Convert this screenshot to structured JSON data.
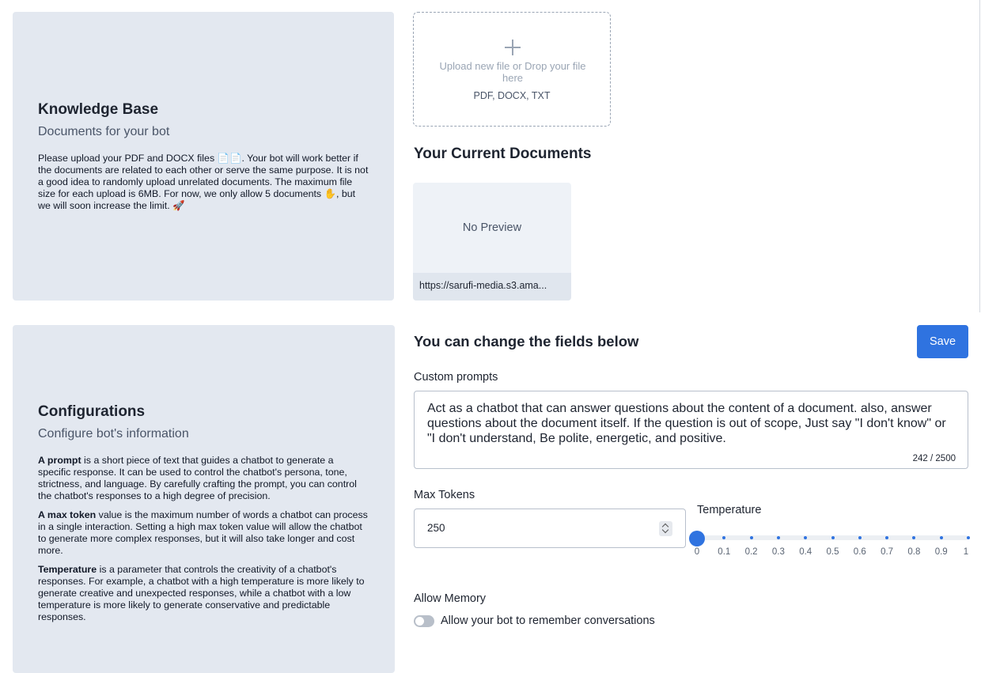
{
  "knowledge_base": {
    "title": "Knowledge Base",
    "subtitle": "Documents for your bot",
    "description": "Please upload your PDF and DOCX files 📄📄. Your bot will work better if the documents are related to each other or serve the same purpose. It is not a good idea to randomly upload unrelated documents. The maximum file size for each upload is 6MB. For now, we only allow 5 documents ✋, but we will soon increase the limit. 🚀"
  },
  "upload": {
    "icon": "plus-icon",
    "prompt": "Upload new file or Drop your file here",
    "types": "PDF, DOCX, TXT"
  },
  "documents": {
    "title": "Your Current Documents",
    "items": [
      {
        "preview": "No Preview",
        "url": "https://sarufi-media.s3.ama..."
      }
    ]
  },
  "configurations": {
    "title": "Configurations",
    "subtitle": "Configure bot's information",
    "prompt_term": "A prompt",
    "prompt_desc": " is a short piece of text that guides a chatbot to generate a specific response. It can be used to control the chatbot's persona, tone, strictness, and language. By carefully crafting the prompt, you can control the chatbot's responses to a high degree of precision.",
    "max_token_term": "A max token",
    "max_token_desc": " value is the maximum number of words a chatbot can process in a single interaction. Setting a high max token value will allow the chatbot to generate more complex responses, but it will also take longer and cost more.",
    "temperature_term": "Temperature",
    "temperature_desc": " is a parameter that controls the creativity of a chatbot's responses. For example, a chatbot with a high temperature is more likely to generate creative and unexpected responses, while a chatbot with a low temperature is more likely to generate conservative and predictable responses."
  },
  "form": {
    "title": "You can change the fields below",
    "save_label": "Save",
    "custom_prompts_label": "Custom prompts",
    "custom_prompt_value": "Act as a chatbot that can answer questions about the content of a document. also, answer questions about the document itself. If the question is out of scope, Just say \"I don't know\" or \"I don't understand, Be polite, energetic, and positive.",
    "custom_prompt_count": "242 / 2500",
    "max_tokens_label": "Max Tokens",
    "max_tokens_value": "250",
    "temperature_label": "Temperature",
    "temperature_value": 0,
    "temperature_ticks": [
      "0",
      "0.1",
      "0.2",
      "0.3",
      "0.4",
      "0.5",
      "0.6",
      "0.7",
      "0.8",
      "0.9",
      "1"
    ],
    "allow_memory_label": "Allow Memory",
    "allow_memory_toggle_label": "Allow your bot to remember conversations",
    "allow_memory_enabled": false
  },
  "colors": {
    "accent": "#2f73e0",
    "panel_bg": "#e3e8f0"
  }
}
